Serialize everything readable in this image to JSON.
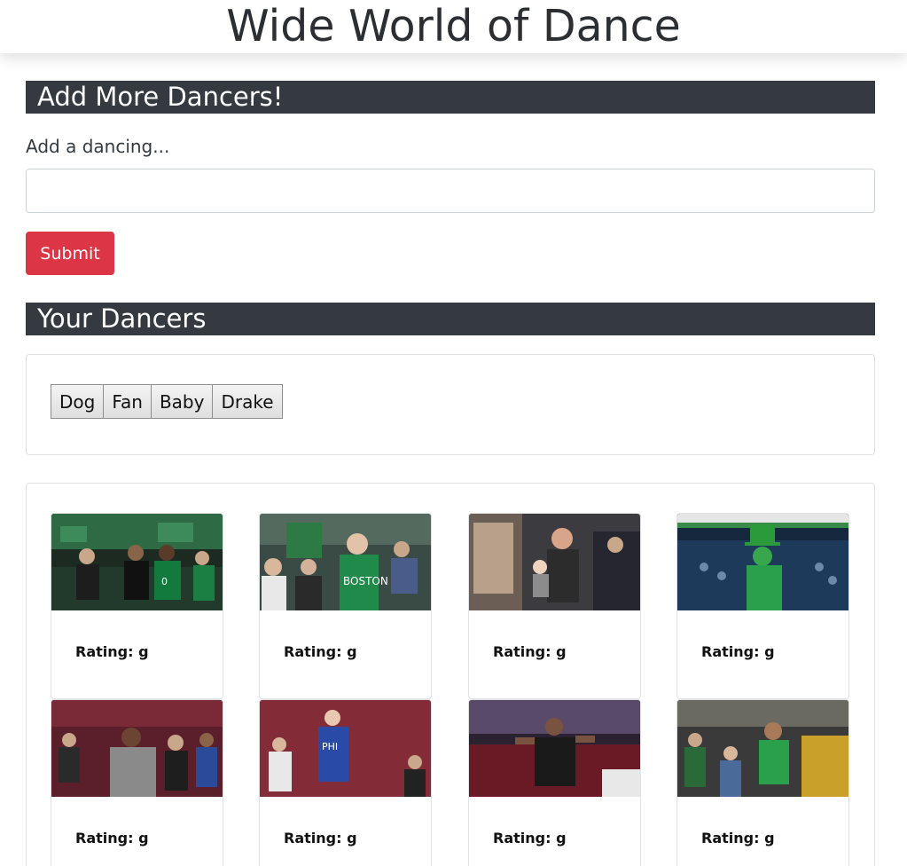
{
  "header": {
    "title": "Wide World of Dance"
  },
  "add_section": {
    "heading": "Add More Dancers!",
    "label": "Add a dancing...",
    "input_value": "",
    "input_placeholder": "",
    "submit_label": "Submit"
  },
  "dancers_section": {
    "heading": "Your Dancers",
    "buttons": [
      "Dog",
      "Fan",
      "Baby",
      "Drake"
    ]
  },
  "gifs": [
    {
      "rating": "Rating: g",
      "scene": "celtics-bench-fans"
    },
    {
      "rating": "Rating: g",
      "scene": "celtics-fan-glasses"
    },
    {
      "rating": "Rating: g",
      "scene": "dancing-baby"
    },
    {
      "rating": "Rating: g",
      "scene": "leprechaun-mascot"
    },
    {
      "rating": "Rating: g",
      "scene": "kid-fan-gray-hoodie"
    },
    {
      "rating": "Rating: g",
      "scene": "sixers-fan-girl"
    },
    {
      "rating": "Rating: g",
      "scene": "arena-dancer-man"
    },
    {
      "rating": "Rating: g",
      "scene": "green-shirt-fan"
    }
  ]
}
